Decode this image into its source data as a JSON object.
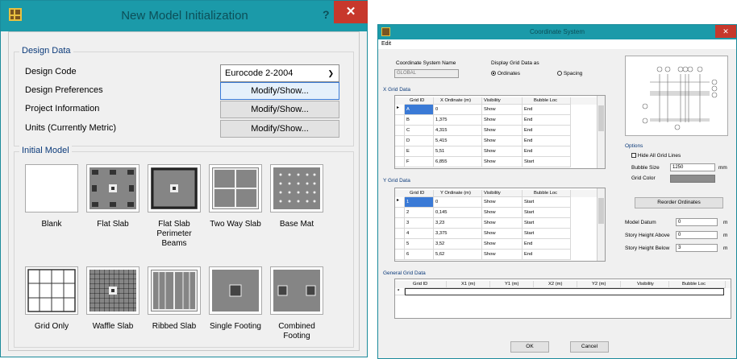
{
  "dlg1": {
    "title": "New Model Initialization",
    "help": "?",
    "close": "✕",
    "design_data": {
      "legend": "Design Data",
      "design_code_label": "Design Code",
      "design_code_value": "Eurocode 2-2004",
      "pref_label": "Design Preferences",
      "proj_label": "Project Information",
      "units_label": "Units  (Currently Metric)",
      "modify": "Modify/Show..."
    },
    "initial": {
      "legend": "Initial Model",
      "tiles": [
        "Blank",
        "Flat Slab",
        "Flat Slab\nPerimeter\nBeams",
        "Two Way Slab",
        "Base Mat",
        "Grid Only",
        "Waffle Slab",
        "Ribbed Slab",
        "Single Footing",
        "Combined\nFooting"
      ]
    }
  },
  "dlg2": {
    "title": "Coordinate System",
    "close": "✕",
    "menu": "Edit",
    "csname_label": "Coordinate System Name",
    "csname_value": "GLOBAL",
    "display_label": "Display Grid Data as",
    "opt_ord": "Ordinates",
    "opt_sp": "Spacing",
    "xgrid": {
      "title": "X Grid Data",
      "cols": [
        "Grid ID",
        "X Ordinate  (m)",
        "Visibility",
        "Bubble Loc"
      ],
      "rows": [
        [
          "A",
          "0",
          "Show",
          "End"
        ],
        [
          "B",
          "1,375",
          "Show",
          "End"
        ],
        [
          "C",
          "4,315",
          "Show",
          "End"
        ],
        [
          "D",
          "5,415",
          "Show",
          "End"
        ],
        [
          "E",
          "5,51",
          "Show",
          "End"
        ],
        [
          "F",
          "6,855",
          "Show",
          "Start"
        ]
      ]
    },
    "ygrid": {
      "title": "Y Grid Data",
      "cols": [
        "Grid ID",
        "Y Ordinate  (m)",
        "Visibility",
        "Bubble Loc"
      ],
      "rows": [
        [
          "1",
          "0",
          "Show",
          "Start"
        ],
        [
          "2",
          "0,145",
          "Show",
          "Start"
        ],
        [
          "3",
          "3,23",
          "Show",
          "Start"
        ],
        [
          "4",
          "3,375",
          "Show",
          "Start"
        ],
        [
          "5",
          "3,52",
          "Show",
          "End"
        ],
        [
          "6",
          "5,62",
          "Show",
          "End"
        ]
      ]
    },
    "general": {
      "title": "General Grid Data",
      "cols": [
        "Grid ID",
        "X1  (m)",
        "Y1  (m)",
        "X2  (m)",
        "Y2  (m)",
        "Visibility",
        "Bubble Loc"
      ],
      "marker": "*"
    },
    "options": {
      "title": "Options",
      "hide": "Hide All Grid Lines",
      "bubble_label": "Bubble Size",
      "bubble_value": "1250",
      "bubble_unit": "mm",
      "color_label": "Grid Color",
      "grid_color": "#8c8c8c"
    },
    "reorder": "Reorder Ordinates",
    "datum_label": "Model Datum",
    "datum_value": "0",
    "above_label": "Story Height Above",
    "above_value": "0",
    "below_label": "Story Height Below",
    "below_value": "3",
    "unit_m": "m",
    "ok": "OK",
    "cancel": "Cancel"
  }
}
